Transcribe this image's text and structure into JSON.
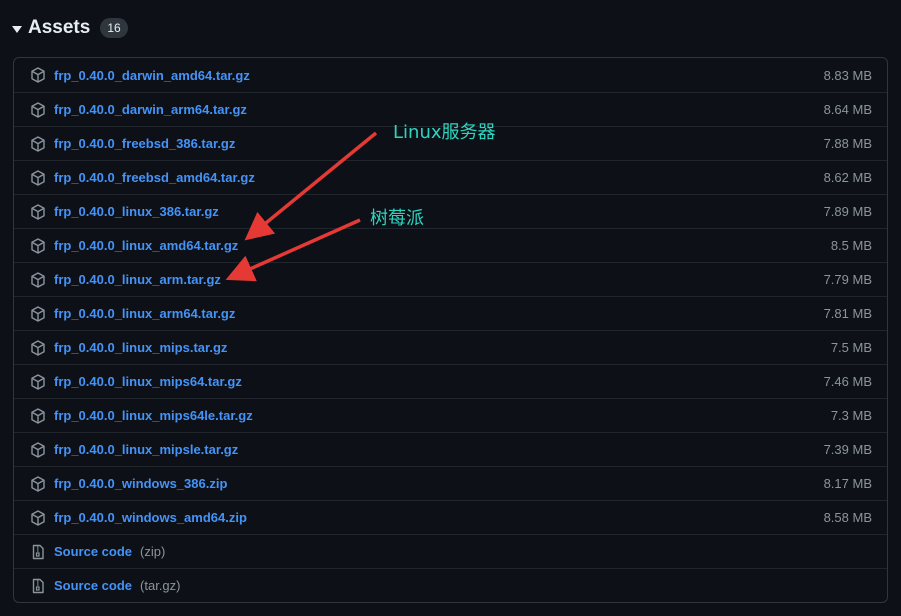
{
  "header": {
    "title": "Assets",
    "count": "16"
  },
  "assets": [
    {
      "name": "frp_0.40.0_darwin_amd64.tar.gz",
      "size": "8.83 MB",
      "icon": "package-icon"
    },
    {
      "name": "frp_0.40.0_darwin_arm64.tar.gz",
      "size": "8.64 MB",
      "icon": "package-icon"
    },
    {
      "name": "frp_0.40.0_freebsd_386.tar.gz",
      "size": "7.88 MB",
      "icon": "package-icon"
    },
    {
      "name": "frp_0.40.0_freebsd_amd64.tar.gz",
      "size": "8.62 MB",
      "icon": "package-icon"
    },
    {
      "name": "frp_0.40.0_linux_386.tar.gz",
      "size": "7.89 MB",
      "icon": "package-icon"
    },
    {
      "name": "frp_0.40.0_linux_amd64.tar.gz",
      "size": "8.5 MB",
      "icon": "package-icon"
    },
    {
      "name": "frp_0.40.0_linux_arm.tar.gz",
      "size": "7.79 MB",
      "icon": "package-icon"
    },
    {
      "name": "frp_0.40.0_linux_arm64.tar.gz",
      "size": "7.81 MB",
      "icon": "package-icon"
    },
    {
      "name": "frp_0.40.0_linux_mips.tar.gz",
      "size": "7.5 MB",
      "icon": "package-icon"
    },
    {
      "name": "frp_0.40.0_linux_mips64.tar.gz",
      "size": "7.46 MB",
      "icon": "package-icon"
    },
    {
      "name": "frp_0.40.0_linux_mips64le.tar.gz",
      "size": "7.3 MB",
      "icon": "package-icon"
    },
    {
      "name": "frp_0.40.0_linux_mipsle.tar.gz",
      "size": "7.39 MB",
      "icon": "package-icon"
    },
    {
      "name": "frp_0.40.0_windows_386.zip",
      "size": "8.17 MB",
      "icon": "package-icon"
    },
    {
      "name": "frp_0.40.0_windows_amd64.zip",
      "size": "8.58 MB",
      "icon": "package-icon"
    }
  ],
  "source": [
    {
      "label": "Source code",
      "suffix": "(zip)",
      "icon": "file-zip-icon"
    },
    {
      "label": "Source code",
      "suffix": "(tar.gz)",
      "icon": "file-zip-icon"
    }
  ],
  "annotations": {
    "linux_server": "Linux服务器",
    "raspberry_pi": "树莓派",
    "color": "#2dd4bf",
    "arrow_color": "#e53935"
  },
  "colors": {
    "background": "#0d1117",
    "link": "#4493f8",
    "muted": "#8b949e",
    "border": "#30363d"
  }
}
